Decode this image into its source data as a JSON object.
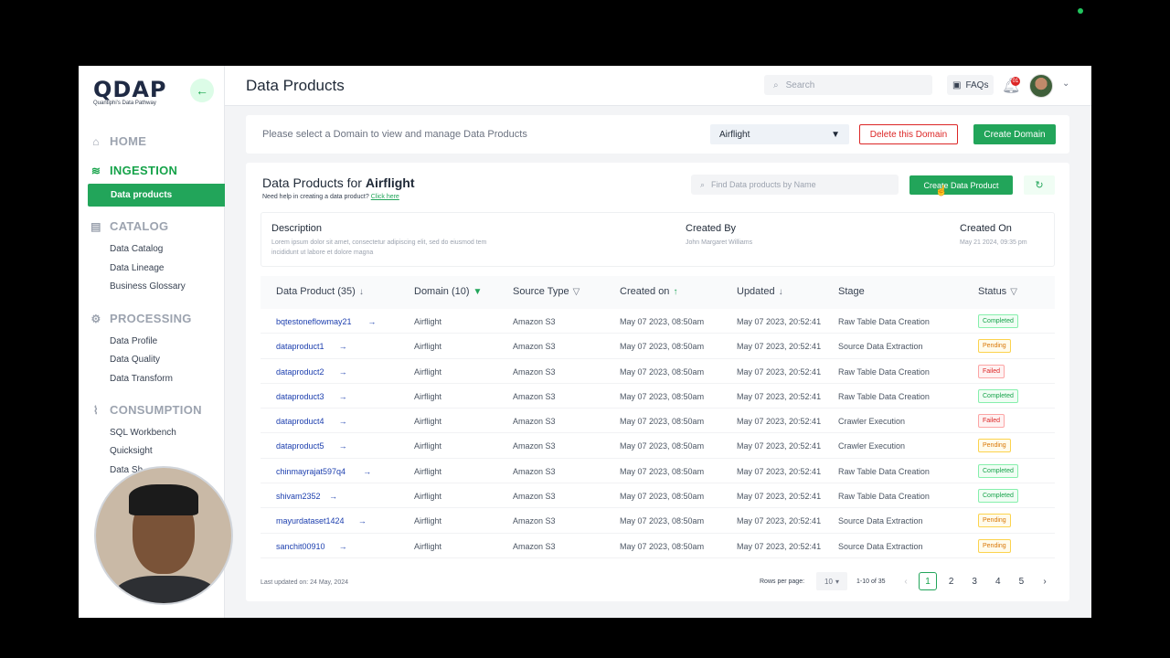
{
  "logo": {
    "name": "QDAP",
    "tagline": "Quantiphi's Data Pathway"
  },
  "sidebar": {
    "sections": [
      {
        "label": "HOME",
        "icon": "home-icon"
      },
      {
        "label": "INGESTION",
        "icon": "database-icon",
        "items": [
          "Data products"
        ]
      },
      {
        "label": "CATALOG",
        "icon": "catalog-icon",
        "items": [
          "Data Catalog",
          "Data Lineage",
          "Business Glossary"
        ]
      },
      {
        "label": "PROCESSING",
        "icon": "processing-icon",
        "items": [
          "Data Profile",
          "Data Quality",
          "Data Transform"
        ]
      },
      {
        "label": "CONSUMPTION",
        "icon": "consumption-icon",
        "items": [
          "SQL Workbench",
          "Quicksight",
          "Data Sh"
        ]
      }
    ]
  },
  "header": {
    "title": "Data Products",
    "search_placeholder": "Search",
    "faqs": "FAQs",
    "notification_count": "01"
  },
  "domain_bar": {
    "prompt": "Please select a Domain to view and manage Data Products",
    "selected_domain": "Airflight",
    "delete_label": "Delete this Domain",
    "create_label": "Create Domain"
  },
  "products": {
    "title_prefix": "Data Products for",
    "title_domain": "Airflight",
    "help_text": "Need help in creating a data product?",
    "help_link": "Click here",
    "find_placeholder": "Find Data products by Name",
    "create_label": "Create Data Product"
  },
  "description": {
    "label": "Description",
    "text_line1": "Lorem ipsum dolor sit amet, consectetur adipiscing elit, sed do eiusmod tem",
    "text_line2": "incididunt ut labore et dolore magna",
    "created_by_label": "Created By",
    "created_by": "John Margaret Williams",
    "created_on_label": "Created On",
    "created_on": "May 21 2024, 09:35 pm"
  },
  "table": {
    "headers": [
      "Data Product (35)",
      "Domain (10)",
      "Source Type",
      "Created on",
      "Updated",
      "Stage",
      "Status"
    ],
    "rows": [
      {
        "name": "bqtestoneflowmay21",
        "domain": "Airflight",
        "source": "Amazon S3",
        "created": "May 07 2023, 08:50am",
        "updated": "May 07 2023, 20:52:41",
        "stage": "Raw Table Data Creation",
        "status": "Completed"
      },
      {
        "name": "dataproduct1",
        "domain": "Airflight",
        "source": "Amazon S3",
        "created": "May 07 2023, 08:50am",
        "updated": "May 07 2023, 20:52:41",
        "stage": "Source Data Extraction",
        "status": "Pending"
      },
      {
        "name": "dataproduct2",
        "domain": "Airflight",
        "source": "Amazon S3",
        "created": "May 07 2023, 08:50am",
        "updated": "May 07 2023, 20:52:41",
        "stage": "Raw Table Data Creation",
        "status": "Failed"
      },
      {
        "name": "dataproduct3",
        "domain": "Airflight",
        "source": "Amazon S3",
        "created": "May 07 2023, 08:50am",
        "updated": "May 07 2023, 20:52:41",
        "stage": "Raw Table Data Creation",
        "status": "Completed"
      },
      {
        "name": "dataproduct4",
        "domain": "Airflight",
        "source": "Amazon S3",
        "created": "May 07 2023, 08:50am",
        "updated": "May 07 2023, 20:52:41",
        "stage": "Crawler Execution",
        "status": "Failed"
      },
      {
        "name": "dataproduct5",
        "domain": "Airflight",
        "source": "Amazon S3",
        "created": "May 07 2023, 08:50am",
        "updated": "May 07 2023, 20:52:41",
        "stage": "Crawler Execution",
        "status": "Pending"
      },
      {
        "name": "chinmayrajat597q4",
        "domain": "Airflight",
        "source": "Amazon S3",
        "created": "May 07 2023, 08:50am",
        "updated": "May 07 2023, 20:52:41",
        "stage": "Raw Table Data Creation",
        "status": "Completed"
      },
      {
        "name": "shivam2352",
        "domain": "Airflight",
        "source": "Amazon S3",
        "created": "May 07 2023, 08:50am",
        "updated": "May 07 2023, 20:52:41",
        "stage": "Raw Table Data Creation",
        "status": "Completed"
      },
      {
        "name": "mayurdataset1424",
        "domain": "Airflight",
        "source": "Amazon S3",
        "created": "May 07 2023, 08:50am",
        "updated": "May 07 2023, 20:52:41",
        "stage": "Source Data Extraction",
        "status": "Pending"
      },
      {
        "name": "sanchit00910",
        "domain": "Airflight",
        "source": "Amazon S3",
        "created": "May 07 2023, 08:50am",
        "updated": "May 07 2023, 20:52:41",
        "stage": "Source Data Extraction",
        "status": "Pending"
      }
    ]
  },
  "pagination": {
    "last_updated": "Last updated on: 24 May, 2024",
    "rows_label": "Rows per page:",
    "rows_value": "10",
    "range": "1-10 of 35",
    "pages": [
      "1",
      "2",
      "3",
      "4",
      "5"
    ],
    "current_page": "1"
  },
  "colors": {
    "accent": "#22a55a",
    "danger": "#dc2626",
    "warning": "#d97706"
  }
}
